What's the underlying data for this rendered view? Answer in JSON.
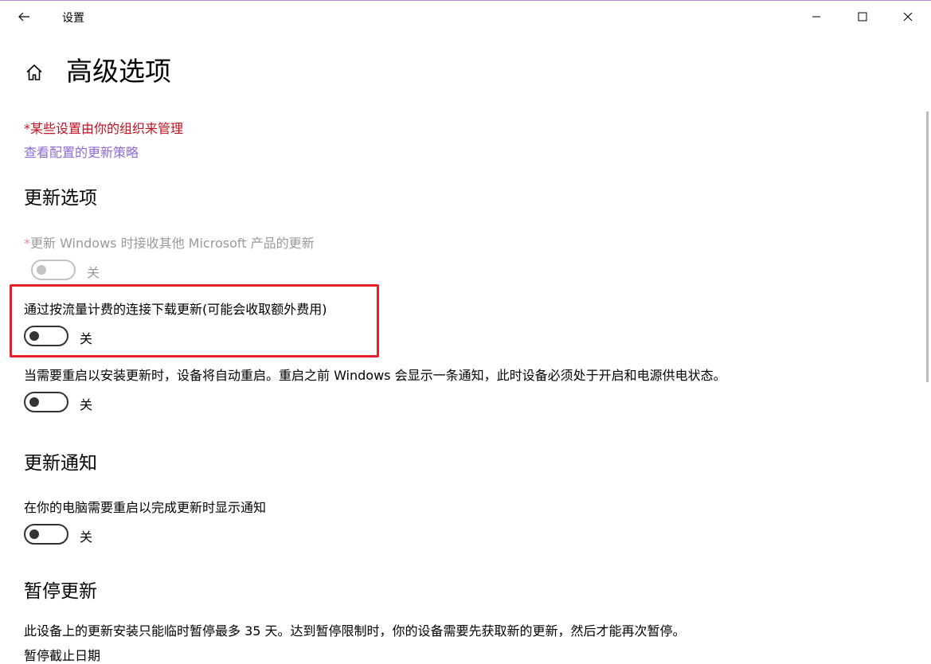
{
  "titlebar": {
    "app_title": "设置",
    "icons": {
      "back": "arrow-left-icon",
      "minimize": "minimize-icon",
      "maximize": "maximize-icon",
      "close": "close-icon"
    }
  },
  "page": {
    "home_icon": "home-icon",
    "title": "高级选项",
    "managed_note": "*某些设置由你的组织来管理",
    "policy_link": "查看配置的更新策略"
  },
  "update_options": {
    "title": "更新选项",
    "other_products": {
      "asterisk": "*",
      "label": "更新 Windows 时接收其他 Microsoft 产品的更新",
      "state": "关",
      "on": false,
      "disabled": true
    },
    "metered": {
      "label": "通过按流量计费的连接下载更新(可能会收取额外费用)",
      "state": "关",
      "on": false
    },
    "auto_restart": {
      "label": "当需要重启以安装更新时，设备将自动重启。重启之前 Windows 会显示一条通知，此时设备必须处于开启和电源供电状态。",
      "state": "关",
      "on": false
    }
  },
  "update_notifications": {
    "title": "更新通知",
    "restart_notify": {
      "label": "在你的电脑需要重启以完成更新时显示通知",
      "state": "关",
      "on": false
    }
  },
  "pause_updates": {
    "title": "暂停更新",
    "description": "此设备上的更新安装只能临时暂停最多 35 天。达到暂停限制时，你的设备需要先获取新的更新，然后才能再次暂停。",
    "pause_until_label": "暂停截止日期"
  },
  "colors": {
    "warning": "#c50f1f",
    "link": "#8e6ad6",
    "highlight": "#e5202a"
  }
}
